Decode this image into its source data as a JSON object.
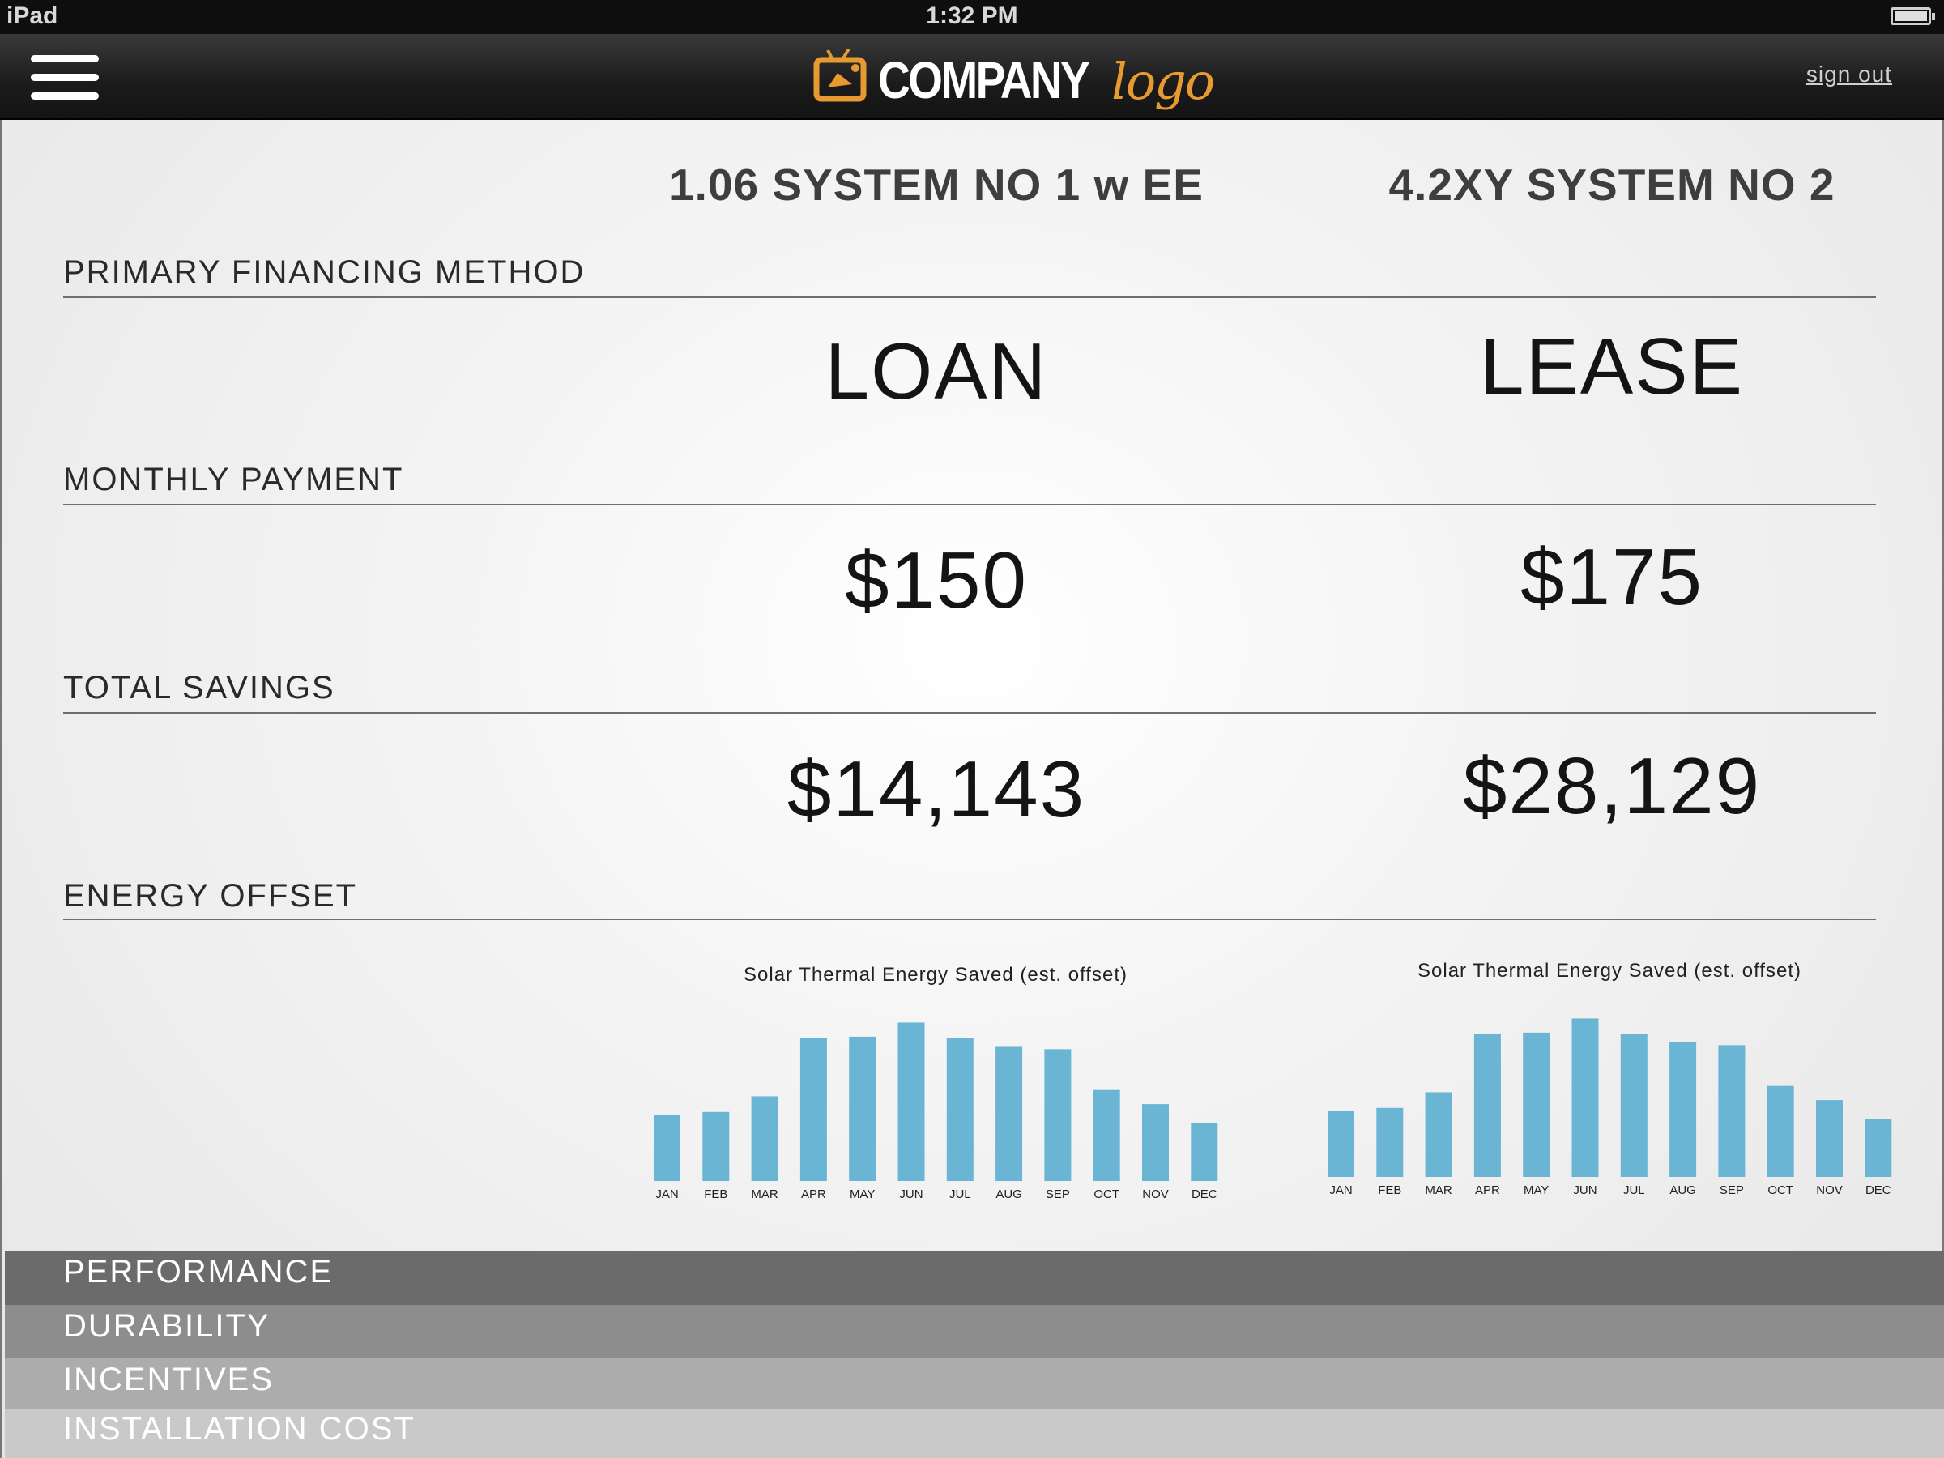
{
  "status_bar": {
    "device": "iPad",
    "time": "1:32 PM"
  },
  "header": {
    "logo_company": "COMPANY",
    "logo_script": "logo",
    "sign_out": "sign out"
  },
  "columns": [
    {
      "title": "1.06 SYSTEM NO 1 w EE"
    },
    {
      "title": "4.2XY SYSTEM NO 2"
    }
  ],
  "sections": {
    "financing": {
      "label": "PRIMARY FINANCING METHOD",
      "values": [
        "LOAN",
        "LEASE"
      ]
    },
    "monthly_payment": {
      "label": "MONTHLY PAYMENT",
      "values": [
        "$150",
        "$175"
      ]
    },
    "total_savings": {
      "label": "TOTAL SAVINGS",
      "values": [
        "$14,143",
        "$28,129"
      ]
    },
    "energy_offset": {
      "label": "ENERGY OFFSET"
    }
  },
  "colors": {
    "bar": "#6ab4d4",
    "logo_accent": "#e79a2f"
  },
  "chart_data": [
    {
      "type": "bar",
      "title": "Solar Thermal Energy Saved (est. offset)",
      "categories": [
        "JAN",
        "FEB",
        "MAR",
        "APR",
        "MAY",
        "JUN",
        "JUL",
        "AUG",
        "SEP",
        "OCT",
        "NOV",
        "DEC"
      ],
      "values": [
        42,
        44,
        54,
        91,
        92,
        101,
        91,
        86,
        84,
        58,
        49,
        37
      ],
      "ylim": [
        0,
        110
      ]
    },
    {
      "type": "bar",
      "title": "Solar Thermal Energy Saved (est. offset)",
      "categories": [
        "JAN",
        "FEB",
        "MAR",
        "APR",
        "MAY",
        "JUN",
        "JUL",
        "AUG",
        "SEP",
        "OCT",
        "NOV",
        "DEC"
      ],
      "values": [
        42,
        44,
        54,
        91,
        92,
        101,
        91,
        86,
        84,
        58,
        49,
        37
      ],
      "ylim": [
        0,
        110
      ]
    }
  ],
  "accordion": [
    {
      "label": "PERFORMANCE",
      "color": "#6b6b6b"
    },
    {
      "label": "DURABILITY",
      "color": "#8d8d8d"
    },
    {
      "label": "INCENTIVES",
      "color": "#acacac"
    },
    {
      "label": "INSTALLATION COST",
      "color": "#c9c9c9"
    }
  ]
}
